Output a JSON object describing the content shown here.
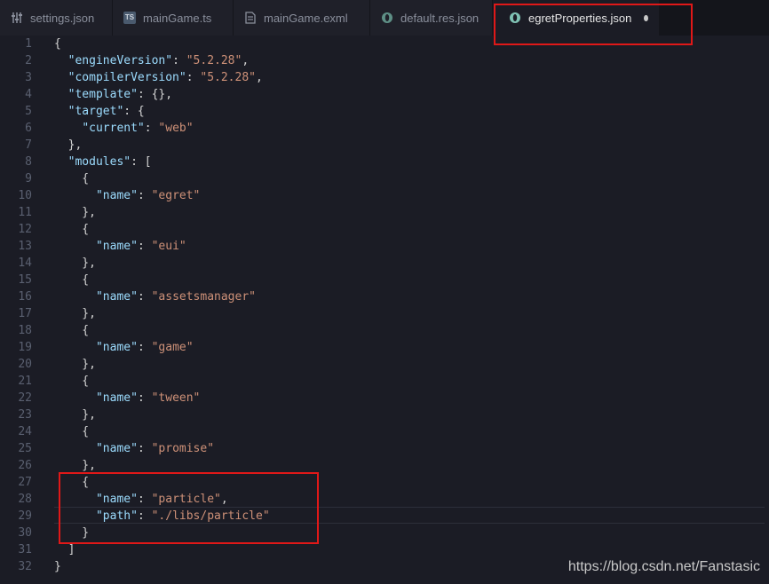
{
  "tabs": [
    {
      "label": "settings.json",
      "icon": "settings-sliders-icon"
    },
    {
      "label": "mainGame.ts",
      "icon": "typescript-file-icon",
      "icon_text": "TS"
    },
    {
      "label": "mainGame.exml",
      "icon": "document-file-icon"
    },
    {
      "label": "default.res.json",
      "icon": "egret-json-icon"
    },
    {
      "label": "egretProperties.json",
      "icon": "egret-json-icon",
      "active": true,
      "unsaved": true
    }
  ],
  "editor": {
    "lines": [
      {
        "n": "1",
        "t": [
          [
            "p",
            "{"
          ]
        ]
      },
      {
        "n": "2",
        "t": [
          [
            "p",
            "  "
          ],
          [
            "k",
            "\"engineVersion\""
          ],
          [
            "p",
            ": "
          ],
          [
            "s",
            "\"5.2.28\""
          ],
          [
            "p",
            ","
          ]
        ]
      },
      {
        "n": "3",
        "t": [
          [
            "p",
            "  "
          ],
          [
            "k",
            "\"compilerVersion\""
          ],
          [
            "p",
            ": "
          ],
          [
            "s",
            "\"5.2.28\""
          ],
          [
            "p",
            ","
          ]
        ]
      },
      {
        "n": "4",
        "t": [
          [
            "p",
            "  "
          ],
          [
            "k",
            "\"template\""
          ],
          [
            "p",
            ": {},"
          ]
        ]
      },
      {
        "n": "5",
        "t": [
          [
            "p",
            "  "
          ],
          [
            "k",
            "\"target\""
          ],
          [
            "p",
            ": {"
          ]
        ]
      },
      {
        "n": "6",
        "t": [
          [
            "p",
            "    "
          ],
          [
            "k",
            "\"current\""
          ],
          [
            "p",
            ": "
          ],
          [
            "s",
            "\"web\""
          ]
        ]
      },
      {
        "n": "7",
        "t": [
          [
            "p",
            "  },"
          ]
        ]
      },
      {
        "n": "8",
        "t": [
          [
            "p",
            "  "
          ],
          [
            "k",
            "\"modules\""
          ],
          [
            "p",
            ": ["
          ]
        ]
      },
      {
        "n": "9",
        "t": [
          [
            "p",
            "    {"
          ]
        ]
      },
      {
        "n": "10",
        "t": [
          [
            "p",
            "      "
          ],
          [
            "k",
            "\"name\""
          ],
          [
            "p",
            ": "
          ],
          [
            "s",
            "\"egret\""
          ]
        ]
      },
      {
        "n": "11",
        "t": [
          [
            "p",
            "    },"
          ]
        ]
      },
      {
        "n": "12",
        "t": [
          [
            "p",
            "    {"
          ]
        ]
      },
      {
        "n": "13",
        "t": [
          [
            "p",
            "      "
          ],
          [
            "k",
            "\"name\""
          ],
          [
            "p",
            ": "
          ],
          [
            "s",
            "\"eui\""
          ]
        ]
      },
      {
        "n": "14",
        "t": [
          [
            "p",
            "    },"
          ]
        ]
      },
      {
        "n": "15",
        "t": [
          [
            "p",
            "    {"
          ]
        ]
      },
      {
        "n": "16",
        "t": [
          [
            "p",
            "      "
          ],
          [
            "k",
            "\"name\""
          ],
          [
            "p",
            ": "
          ],
          [
            "s",
            "\"assetsmanager\""
          ]
        ]
      },
      {
        "n": "17",
        "t": [
          [
            "p",
            "    },"
          ]
        ]
      },
      {
        "n": "18",
        "t": [
          [
            "p",
            "    {"
          ]
        ]
      },
      {
        "n": "19",
        "t": [
          [
            "p",
            "      "
          ],
          [
            "k",
            "\"name\""
          ],
          [
            "p",
            ": "
          ],
          [
            "s",
            "\"game\""
          ]
        ]
      },
      {
        "n": "20",
        "t": [
          [
            "p",
            "    },"
          ]
        ]
      },
      {
        "n": "21",
        "t": [
          [
            "p",
            "    {"
          ]
        ]
      },
      {
        "n": "22",
        "t": [
          [
            "p",
            "      "
          ],
          [
            "k",
            "\"name\""
          ],
          [
            "p",
            ": "
          ],
          [
            "s",
            "\"tween\""
          ]
        ]
      },
      {
        "n": "23",
        "t": [
          [
            "p",
            "    },"
          ]
        ]
      },
      {
        "n": "24",
        "t": [
          [
            "p",
            "    {"
          ]
        ]
      },
      {
        "n": "25",
        "t": [
          [
            "p",
            "      "
          ],
          [
            "k",
            "\"name\""
          ],
          [
            "p",
            ": "
          ],
          [
            "s",
            "\"promise\""
          ]
        ]
      },
      {
        "n": "26",
        "t": [
          [
            "p",
            "    },"
          ]
        ]
      },
      {
        "n": "27",
        "t": [
          [
            "p",
            "    {"
          ]
        ]
      },
      {
        "n": "28",
        "t": [
          [
            "p",
            "      "
          ],
          [
            "k",
            "\"name\""
          ],
          [
            "p",
            ": "
          ],
          [
            "s",
            "\"particle\""
          ],
          [
            "p",
            ","
          ]
        ]
      },
      {
        "n": "29",
        "t": [
          [
            "p",
            "      "
          ],
          [
            "k",
            "\"path\""
          ],
          [
            "p",
            ": "
          ],
          [
            "s",
            "\"./libs/particle\""
          ]
        ]
      },
      {
        "n": "30",
        "t": [
          [
            "p",
            "    }"
          ]
        ]
      },
      {
        "n": "31",
        "t": [
          [
            "p",
            "  ]"
          ]
        ]
      },
      {
        "n": "32",
        "t": [
          [
            "p",
            "}"
          ]
        ]
      }
    ]
  },
  "watermark": "https://blog.csdn.net/Fanstasic",
  "colors": {
    "background": "#1b1c25",
    "key": "#9cdcfe",
    "string": "#ce9178",
    "highlight_box": "#e01818"
  }
}
